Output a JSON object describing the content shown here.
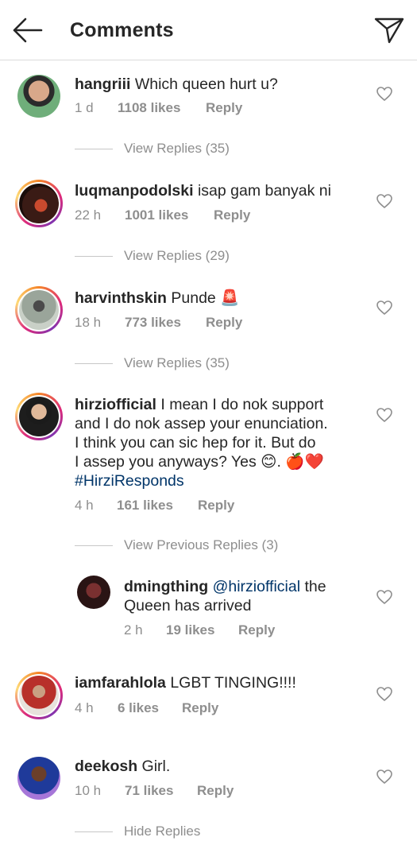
{
  "header": {
    "title": "Comments"
  },
  "comments": [
    {
      "username": "hangriii",
      "text": "Which queen hurt u?",
      "time": "1 d",
      "likes": "1108 likes",
      "reply": "Reply",
      "view_replies": "View Replies (35)"
    },
    {
      "username": "luqmanpodolski",
      "text": "isap gam banyak ni",
      "time": "22 h",
      "likes": "1001 likes",
      "reply": "Reply",
      "view_replies": "View Replies (29)"
    },
    {
      "username": "harvinthskin",
      "text": "Punde 🚨",
      "time": "18 h",
      "likes": "773 likes",
      "reply": "Reply",
      "view_replies": "View Replies (35)"
    },
    {
      "username": "hirziofficial",
      "line1": "I mean I do nok support",
      "line2": "and I do nok assep your enunciation.",
      "line3": "I think you can sic hep for it. But do",
      "line4": "I assep you anyways? Yes 😊. 🍎❤️",
      "hashtag": "#HirziResponds",
      "time": "4 h",
      "likes": "161 likes",
      "reply": "Reply",
      "view_replies": "View Previous Replies (3)"
    },
    {
      "username": "iamfarahlola",
      "text": "LGBT TINGING!!!!",
      "time": "4 h",
      "likes": "6 likes",
      "reply": "Reply"
    },
    {
      "username": "deekosh",
      "text": "Girl.",
      "time": "10 h",
      "likes": "71 likes",
      "reply": "Reply",
      "view_replies": "Hide Replies"
    }
  ],
  "reply": {
    "username": "dmingthing",
    "mention": "@hirziofficial",
    "text1": "the",
    "text2": "Queen has arrived",
    "time": "2 h",
    "likes": "19 likes",
    "reply": "Reply"
  }
}
